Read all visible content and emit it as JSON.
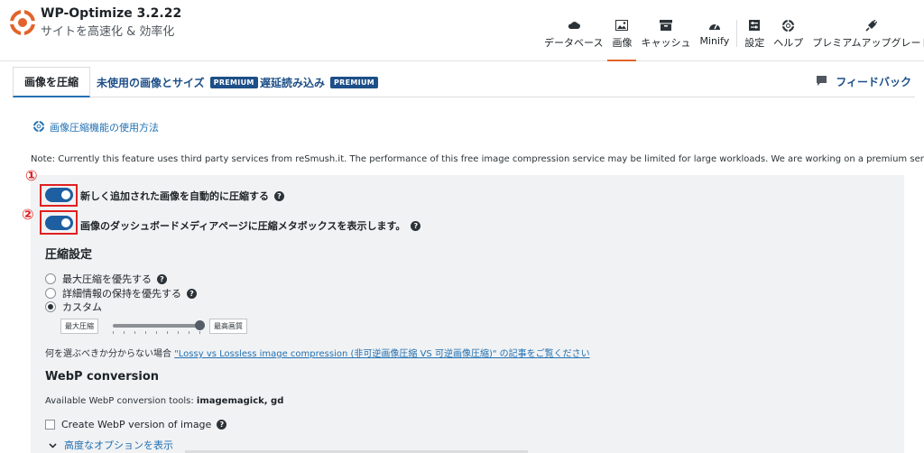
{
  "app": {
    "title": "WP-Optimize 3.2.22",
    "subtitle": "サイトを高速化 & 効率化",
    "accent_color": "#e2642a",
    "link_color": "#2271b1",
    "toggle_color": "#1d5fa0",
    "callout_color": "#e02020"
  },
  "nav": {
    "items": [
      {
        "label": "データベース",
        "icon": "cloud-icon",
        "active": false
      },
      {
        "label": "画像",
        "icon": "image-icon",
        "active": true
      },
      {
        "label": "キャッシュ",
        "icon": "archive-icon",
        "active": false
      },
      {
        "label": "Minify",
        "icon": "dashboard-icon",
        "active": false
      },
      {
        "label": "設定",
        "icon": "settings-icon",
        "active": false
      },
      {
        "label": "ヘルプ",
        "icon": "lifebuoy-icon",
        "active": false
      },
      {
        "label": "プレミアムアップグレード",
        "icon": "plug-icon",
        "active": false
      }
    ]
  },
  "tabs": [
    {
      "label": "画像を圧縮",
      "active": true,
      "badge": ""
    },
    {
      "label": "未使用の画像とサイズ",
      "active": false,
      "badge": "PREMIUM"
    },
    {
      "label": "遅延読み込み",
      "active": false,
      "badge": "PREMIUM"
    }
  ],
  "feedback_label": "フィードバック",
  "help_link": "画像圧縮機能の使用方法",
  "note": "Note: Currently this feature uses third party services from reSmush.it. The performance of this free image compression service may be limited for large workloads. We are working on a premium service.",
  "callouts": [
    "①",
    "②"
  ],
  "options": [
    {
      "label": "新しく追加された画像を自動的に圧縮する",
      "enabled": true
    },
    {
      "label": "画像のダッシュボードメディアページに圧縮メタボックスを表示します。",
      "enabled": true
    }
  ],
  "compression": {
    "title": "圧縮設定",
    "radios": [
      {
        "label": "最大圧縮を優先する",
        "checked": false,
        "help": true
      },
      {
        "label": "詳細情報の保持を優先する",
        "checked": false,
        "help": true
      },
      {
        "label": "カスタム",
        "checked": true,
        "help": false
      }
    ],
    "slider": {
      "min_label": "最大圧縮",
      "max_label": "最高画質",
      "value_fraction": 1.0,
      "ticks": 9
    },
    "hint_prefix": "何を選ぶべきか分からない場合 ",
    "hint_link": "\"Lossy vs Lossless image compression (非可逆画像圧縮 VS 可逆画像圧縮)\" の記事をご覧ください"
  },
  "webp": {
    "title": "WebP conversion",
    "tools_label": "Available WebP conversion tools: ",
    "tools_value": "imagemagick, gd",
    "checkbox_label": "Create WebP version of image",
    "checkbox_checked": false
  },
  "advanced_link": "高度なオプションを表示"
}
